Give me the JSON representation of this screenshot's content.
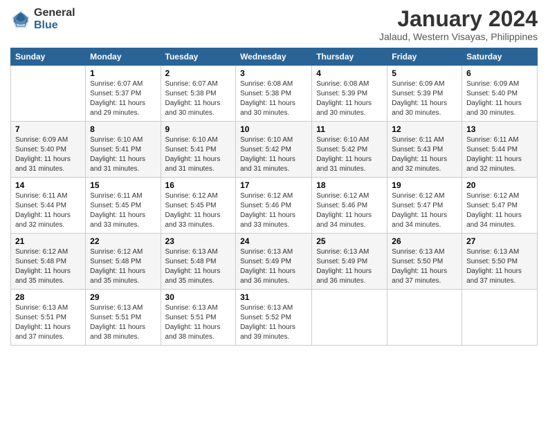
{
  "logo": {
    "general": "General",
    "blue": "Blue"
  },
  "title": "January 2024",
  "subtitle": "Jalaud, Western Visayas, Philippines",
  "days_header": [
    "Sunday",
    "Monday",
    "Tuesday",
    "Wednesday",
    "Thursday",
    "Friday",
    "Saturday"
  ],
  "weeks": [
    [
      {
        "day": "",
        "sunrise": "",
        "sunset": "",
        "daylight": ""
      },
      {
        "day": "1",
        "sunrise": "Sunrise: 6:07 AM",
        "sunset": "Sunset: 5:37 PM",
        "daylight": "Daylight: 11 hours and 29 minutes."
      },
      {
        "day": "2",
        "sunrise": "Sunrise: 6:07 AM",
        "sunset": "Sunset: 5:38 PM",
        "daylight": "Daylight: 11 hours and 30 minutes."
      },
      {
        "day": "3",
        "sunrise": "Sunrise: 6:08 AM",
        "sunset": "Sunset: 5:38 PM",
        "daylight": "Daylight: 11 hours and 30 minutes."
      },
      {
        "day": "4",
        "sunrise": "Sunrise: 6:08 AM",
        "sunset": "Sunset: 5:39 PM",
        "daylight": "Daylight: 11 hours and 30 minutes."
      },
      {
        "day": "5",
        "sunrise": "Sunrise: 6:09 AM",
        "sunset": "Sunset: 5:39 PM",
        "daylight": "Daylight: 11 hours and 30 minutes."
      },
      {
        "day": "6",
        "sunrise": "Sunrise: 6:09 AM",
        "sunset": "Sunset: 5:40 PM",
        "daylight": "Daylight: 11 hours and 30 minutes."
      }
    ],
    [
      {
        "day": "7",
        "sunrise": "Sunrise: 6:09 AM",
        "sunset": "Sunset: 5:40 PM",
        "daylight": "Daylight: 11 hours and 31 minutes."
      },
      {
        "day": "8",
        "sunrise": "Sunrise: 6:10 AM",
        "sunset": "Sunset: 5:41 PM",
        "daylight": "Daylight: 11 hours and 31 minutes."
      },
      {
        "day": "9",
        "sunrise": "Sunrise: 6:10 AM",
        "sunset": "Sunset: 5:41 PM",
        "daylight": "Daylight: 11 hours and 31 minutes."
      },
      {
        "day": "10",
        "sunrise": "Sunrise: 6:10 AM",
        "sunset": "Sunset: 5:42 PM",
        "daylight": "Daylight: 11 hours and 31 minutes."
      },
      {
        "day": "11",
        "sunrise": "Sunrise: 6:10 AM",
        "sunset": "Sunset: 5:42 PM",
        "daylight": "Daylight: 11 hours and 31 minutes."
      },
      {
        "day": "12",
        "sunrise": "Sunrise: 6:11 AM",
        "sunset": "Sunset: 5:43 PM",
        "daylight": "Daylight: 11 hours and 32 minutes."
      },
      {
        "day": "13",
        "sunrise": "Sunrise: 6:11 AM",
        "sunset": "Sunset: 5:44 PM",
        "daylight": "Daylight: 11 hours and 32 minutes."
      }
    ],
    [
      {
        "day": "14",
        "sunrise": "Sunrise: 6:11 AM",
        "sunset": "Sunset: 5:44 PM",
        "daylight": "Daylight: 11 hours and 32 minutes."
      },
      {
        "day": "15",
        "sunrise": "Sunrise: 6:11 AM",
        "sunset": "Sunset: 5:45 PM",
        "daylight": "Daylight: 11 hours and 33 minutes."
      },
      {
        "day": "16",
        "sunrise": "Sunrise: 6:12 AM",
        "sunset": "Sunset: 5:45 PM",
        "daylight": "Daylight: 11 hours and 33 minutes."
      },
      {
        "day": "17",
        "sunrise": "Sunrise: 6:12 AM",
        "sunset": "Sunset: 5:46 PM",
        "daylight": "Daylight: 11 hours and 33 minutes."
      },
      {
        "day": "18",
        "sunrise": "Sunrise: 6:12 AM",
        "sunset": "Sunset: 5:46 PM",
        "daylight": "Daylight: 11 hours and 34 minutes."
      },
      {
        "day": "19",
        "sunrise": "Sunrise: 6:12 AM",
        "sunset": "Sunset: 5:47 PM",
        "daylight": "Daylight: 11 hours and 34 minutes."
      },
      {
        "day": "20",
        "sunrise": "Sunrise: 6:12 AM",
        "sunset": "Sunset: 5:47 PM",
        "daylight": "Daylight: 11 hours and 34 minutes."
      }
    ],
    [
      {
        "day": "21",
        "sunrise": "Sunrise: 6:12 AM",
        "sunset": "Sunset: 5:48 PM",
        "daylight": "Daylight: 11 hours and 35 minutes."
      },
      {
        "day": "22",
        "sunrise": "Sunrise: 6:12 AM",
        "sunset": "Sunset: 5:48 PM",
        "daylight": "Daylight: 11 hours and 35 minutes."
      },
      {
        "day": "23",
        "sunrise": "Sunrise: 6:13 AM",
        "sunset": "Sunset: 5:48 PM",
        "daylight": "Daylight: 11 hours and 35 minutes."
      },
      {
        "day": "24",
        "sunrise": "Sunrise: 6:13 AM",
        "sunset": "Sunset: 5:49 PM",
        "daylight": "Daylight: 11 hours and 36 minutes."
      },
      {
        "day": "25",
        "sunrise": "Sunrise: 6:13 AM",
        "sunset": "Sunset: 5:49 PM",
        "daylight": "Daylight: 11 hours and 36 minutes."
      },
      {
        "day": "26",
        "sunrise": "Sunrise: 6:13 AM",
        "sunset": "Sunset: 5:50 PM",
        "daylight": "Daylight: 11 hours and 37 minutes."
      },
      {
        "day": "27",
        "sunrise": "Sunrise: 6:13 AM",
        "sunset": "Sunset: 5:50 PM",
        "daylight": "Daylight: 11 hours and 37 minutes."
      }
    ],
    [
      {
        "day": "28",
        "sunrise": "Sunrise: 6:13 AM",
        "sunset": "Sunset: 5:51 PM",
        "daylight": "Daylight: 11 hours and 37 minutes."
      },
      {
        "day": "29",
        "sunrise": "Sunrise: 6:13 AM",
        "sunset": "Sunset: 5:51 PM",
        "daylight": "Daylight: 11 hours and 38 minutes."
      },
      {
        "day": "30",
        "sunrise": "Sunrise: 6:13 AM",
        "sunset": "Sunset: 5:51 PM",
        "daylight": "Daylight: 11 hours and 38 minutes."
      },
      {
        "day": "31",
        "sunrise": "Sunrise: 6:13 AM",
        "sunset": "Sunset: 5:52 PM",
        "daylight": "Daylight: 11 hours and 39 minutes."
      },
      {
        "day": "",
        "sunrise": "",
        "sunset": "",
        "daylight": ""
      },
      {
        "day": "",
        "sunrise": "",
        "sunset": "",
        "daylight": ""
      },
      {
        "day": "",
        "sunrise": "",
        "sunset": "",
        "daylight": ""
      }
    ]
  ]
}
